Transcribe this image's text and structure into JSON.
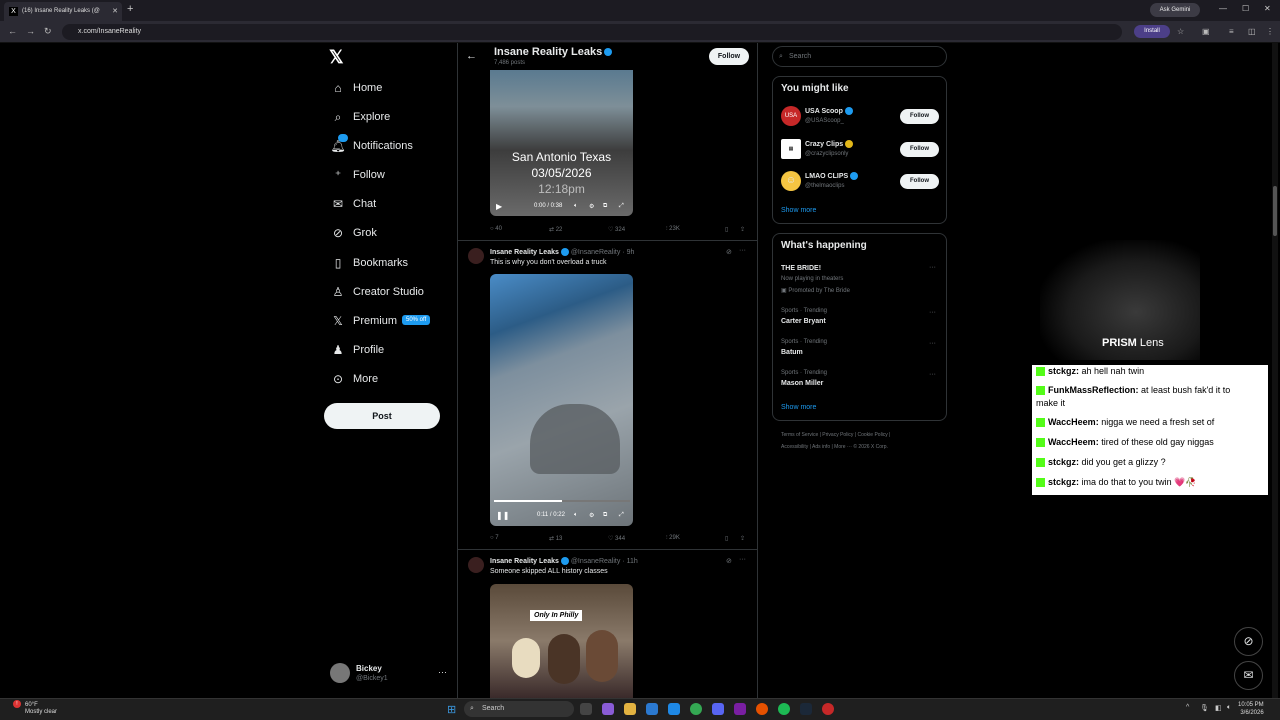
{
  "browser": {
    "tab_title": "(16) Insane Reality Leaks (@",
    "ask_gemini": "Ask Gemini",
    "url": "x.com/InsaneReality",
    "install": "Install"
  },
  "nav": {
    "items": [
      {
        "label": "Home",
        "icon": "home-icon"
      },
      {
        "label": "Explore",
        "icon": "search-icon"
      },
      {
        "label": "Notifications",
        "icon": "bell-icon"
      },
      {
        "label": "Follow",
        "icon": "person-plus-icon"
      },
      {
        "label": "Chat",
        "icon": "mail-icon"
      },
      {
        "label": "Grok",
        "icon": "grok-icon"
      },
      {
        "label": "Bookmarks",
        "icon": "bookmark-icon"
      },
      {
        "label": "Creator Studio",
        "icon": "creator-icon"
      },
      {
        "label": "Premium",
        "icon": "x-icon"
      },
      {
        "label": "Profile",
        "icon": "person-icon"
      },
      {
        "label": "More",
        "icon": "more-circle-icon"
      }
    ],
    "premium_badge": "50% off",
    "post": "Post",
    "user": {
      "name": "Bickey",
      "handle": "@Bickey1"
    }
  },
  "profile": {
    "name": "Insane Reality Leaks",
    "posts": "7,486 posts",
    "follow": "Follow"
  },
  "tweets": [
    {
      "video_text": [
        "San Antonio Texas",
        "03/05/2026",
        "12:18pm"
      ],
      "time": "0:00 / 0:38",
      "replies": "40",
      "reposts": "22",
      "likes": "324",
      "views": "23K"
    },
    {
      "name": "Insane Reality Leaks",
      "handle": "@InsaneReality",
      "age": "9h",
      "text": "This is why you don't overload a truck",
      "time": "0:11 / 0:22",
      "progress": 0.5,
      "replies": "7",
      "reposts": "13",
      "likes": "344",
      "views": "29K"
    },
    {
      "name": "Insane Reality Leaks",
      "handle": "@InsaneReality",
      "age": "11h",
      "text": "Someone skipped ALL history classes",
      "image_caption": "Only In Philly"
    }
  ],
  "right": {
    "search_placeholder": "Search",
    "you_might_like": "You might like",
    "suggestions": [
      {
        "name": "USA Scoop",
        "handle": "@USAScoop_",
        "follow": "Follow"
      },
      {
        "name": "Crazy Clips",
        "handle": "@crazyclipsonly",
        "follow": "Follow"
      },
      {
        "name": "LMAO CLIPS",
        "handle": "@thelmaoclips",
        "follow": "Follow"
      }
    ],
    "show_more": "Show more",
    "whats_happening": "What's happening",
    "trends": [
      {
        "category": "",
        "name": "THE BRIDE!",
        "sub1": "Now playing in theaters",
        "sub2": "Promoted by The Bride"
      },
      {
        "category": "Sports · Trending",
        "name": "Carter Bryant"
      },
      {
        "category": "Sports · Trending",
        "name": "Batum"
      },
      {
        "category": "Sports · Trending",
        "name": "Mason Miller"
      }
    ],
    "footer1": "Terms of Service  |  Privacy Policy  |  Cookie Policy  |",
    "footer2": "Accessibility  |  Ads info  |  More ···  © 2026 X Corp."
  },
  "stream": {
    "prism_bold": "PRISM",
    "prism_rest": " Lens",
    "chat": [
      {
        "user": "stckgz:",
        "msg": "ah hell nah twin"
      },
      {
        "user": "FunkMassReflection:",
        "msg": "at least bush fak'd it to"
      },
      {
        "user": "",
        "msg": "make it"
      },
      {
        "user": "WaccHeem:",
        "msg": "nigga we need a fresh set of"
      },
      {
        "user": "WaccHeem:",
        "msg": "tired of these old gay niggas"
      },
      {
        "user": "stckgz:",
        "msg": "did you get a glizzy ?"
      },
      {
        "user": "stckgz:",
        "msg": "ima do that to you twin 💗🥀"
      }
    ]
  },
  "taskbar": {
    "temp": "60°F",
    "weather": "Mostly clear",
    "search": "Search",
    "time": "10:05 PM",
    "date": "3/6/2026"
  },
  "colors": {
    "accent": "#1d9bf0",
    "gold": "#e2b719",
    "kick_green": "#53fc18"
  }
}
